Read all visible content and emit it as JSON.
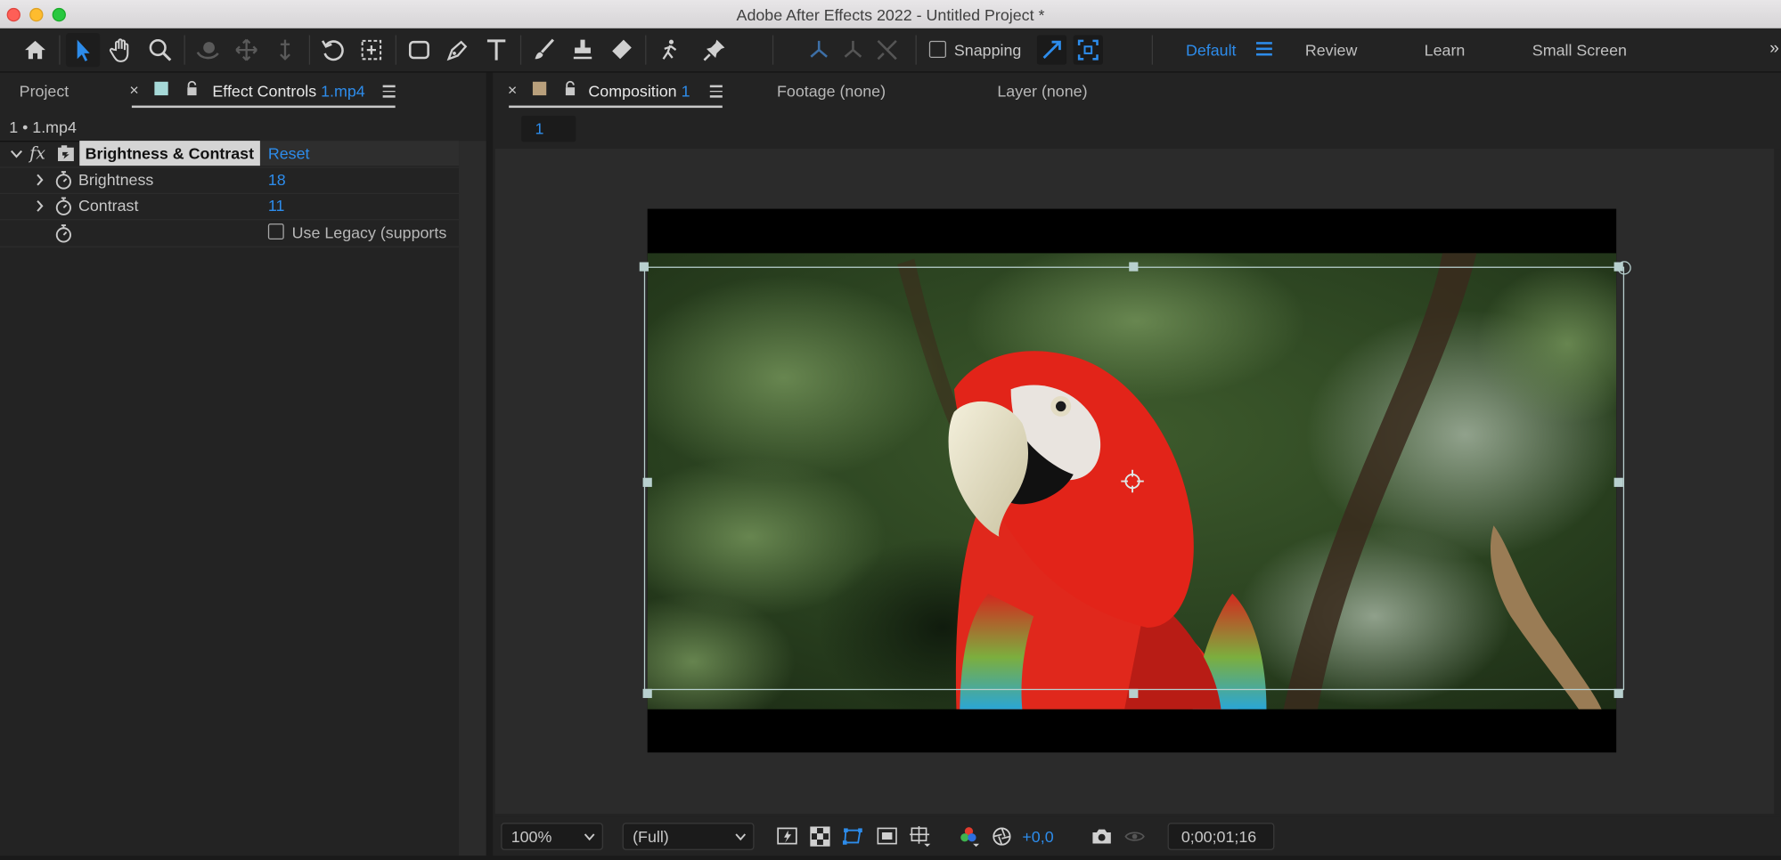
{
  "window": {
    "title": "Adobe After Effects 2022 - Untitled Project *"
  },
  "toolbar": {
    "snapping_label": "Snapping",
    "workspaces": [
      "Default",
      "Review",
      "Learn",
      "Small Screen"
    ],
    "active_workspace": "Default"
  },
  "left_panel": {
    "project_tab": "Project",
    "effect_controls_tab": "Effect Controls",
    "effect_controls_layer": "1.mp4",
    "layer_path": "1 • 1.mp4",
    "effect": {
      "fx_label": "fx",
      "name": "Brightness & Contrast",
      "reset_label": "Reset",
      "properties": [
        {
          "name": "Brightness",
          "value": "18"
        },
        {
          "name": "Contrast",
          "value": "11"
        }
      ],
      "legacy_label": "Use Legacy (supports"
    }
  },
  "comp_panel": {
    "composition_tab": "Composition",
    "composition_name": "1",
    "footage_tab": "Footage (none)",
    "layer_tab": "Layer (none)",
    "comp_chip": "1"
  },
  "viewer_bar": {
    "zoom": "100%",
    "resolution": "(Full)",
    "exposure": "+0,0",
    "timecode": "0;00;01;16"
  },
  "colors": {
    "accent": "#2d8ceb",
    "panel_bg": "#232323",
    "viewer_bg": "#2b2b2b",
    "effect_controls_label": "#a6d9d8",
    "composition_label": "#b9a07c"
  }
}
